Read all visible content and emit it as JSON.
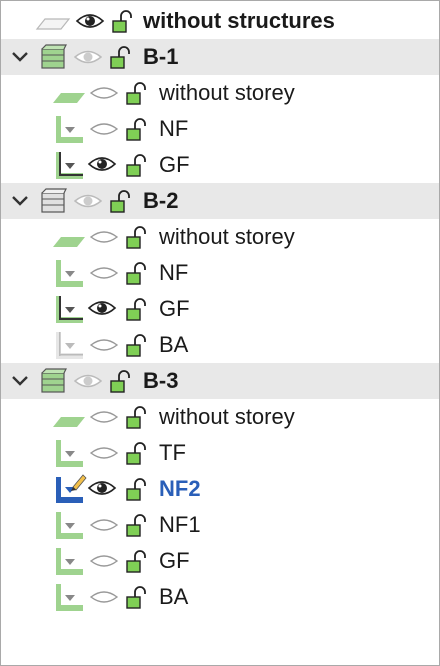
{
  "tree": {
    "root": {
      "label": "without structures"
    },
    "buildings": [
      {
        "label": "B-1",
        "storeys": [
          {
            "label": "without storey",
            "kind": "nostorey",
            "visible": false,
            "active": false
          },
          {
            "label": "NF",
            "kind": "storey",
            "visible": false,
            "active": false
          },
          {
            "label": "GF",
            "kind": "storey-dark",
            "visible": true,
            "active": false
          }
        ]
      },
      {
        "label": "B-2",
        "storeys": [
          {
            "label": "without storey",
            "kind": "nostorey",
            "visible": false,
            "active": false
          },
          {
            "label": "NF",
            "kind": "storey",
            "visible": false,
            "active": false
          },
          {
            "label": "GF",
            "kind": "storey-dark",
            "visible": true,
            "active": false
          },
          {
            "label": "BA",
            "kind": "storey-grey",
            "visible": false,
            "active": false
          }
        ]
      },
      {
        "label": "B-3",
        "storeys": [
          {
            "label": "without storey",
            "kind": "nostorey",
            "visible": false,
            "active": false
          },
          {
            "label": "TF",
            "kind": "storey",
            "visible": false,
            "active": false
          },
          {
            "label": "NF2",
            "kind": "storey-active",
            "visible": true,
            "active": true
          },
          {
            "label": "NF1",
            "kind": "storey",
            "visible": false,
            "active": false
          },
          {
            "label": "GF",
            "kind": "storey",
            "visible": false,
            "active": false
          },
          {
            "label": "BA",
            "kind": "storey",
            "visible": false,
            "active": false
          }
        ]
      }
    ]
  },
  "colors": {
    "group_bg": "#e8e8e8",
    "storey_green": "#9fd38f",
    "lock_green": "#6fbf4a",
    "active_text": "#2a5fb8"
  }
}
